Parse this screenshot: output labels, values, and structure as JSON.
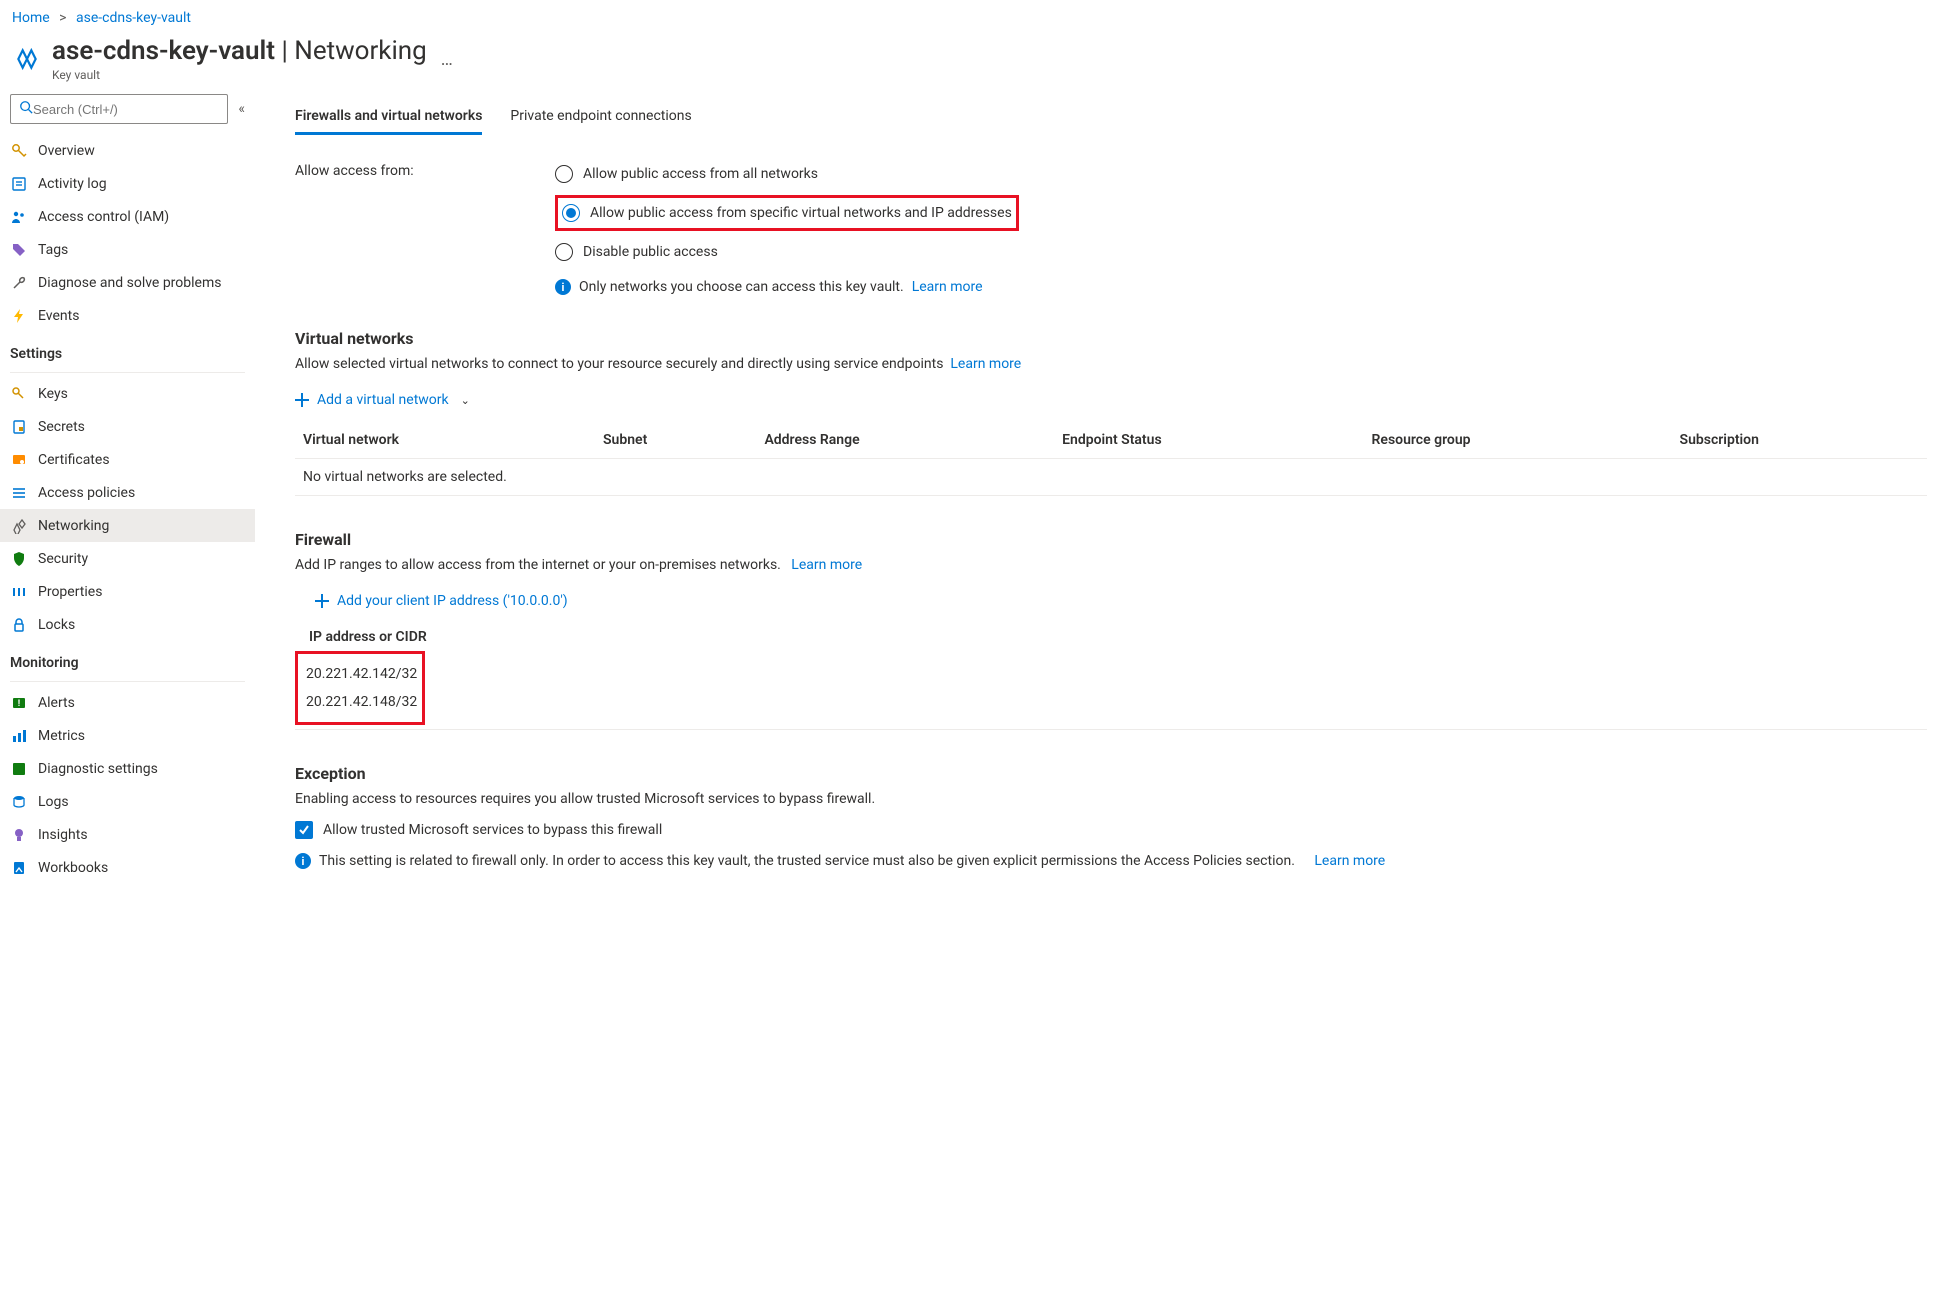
{
  "breadcrumb": {
    "home": "Home",
    "resource": "ase-cdns-key-vault"
  },
  "header": {
    "title_main": "ase-cdns-key-vault",
    "title_sep": " | ",
    "title_sub": "Networking",
    "subtitle": "Key vault",
    "more": "…"
  },
  "search": {
    "placeholder": "Search (Ctrl+/)"
  },
  "sidebar": {
    "items_top": [
      {
        "label": "Overview"
      },
      {
        "label": "Activity log"
      },
      {
        "label": "Access control (IAM)"
      },
      {
        "label": "Tags"
      },
      {
        "label": "Diagnose and solve problems"
      },
      {
        "label": "Events"
      }
    ],
    "section_settings": "Settings",
    "items_settings": [
      {
        "label": "Keys"
      },
      {
        "label": "Secrets"
      },
      {
        "label": "Certificates"
      },
      {
        "label": "Access policies"
      },
      {
        "label": "Networking",
        "active": true
      },
      {
        "label": "Security"
      },
      {
        "label": "Properties"
      },
      {
        "label": "Locks"
      }
    ],
    "section_monitoring": "Monitoring",
    "items_monitoring": [
      {
        "label": "Alerts"
      },
      {
        "label": "Metrics"
      },
      {
        "label": "Diagnostic settings"
      },
      {
        "label": "Logs"
      },
      {
        "label": "Insights"
      },
      {
        "label": "Workbooks"
      }
    ]
  },
  "tabs": {
    "firewalls": "Firewalls and virtual networks",
    "private": "Private endpoint connections"
  },
  "access": {
    "label": "Allow access from:",
    "opt_all": "Allow public access from all networks",
    "opt_specific": "Allow public access from specific virtual networks and IP addresses",
    "opt_disable": "Disable public access",
    "info_text": "Only networks you choose can access this key vault.",
    "info_link": "Learn more"
  },
  "vnet": {
    "heading": "Virtual networks",
    "desc": "Allow selected virtual networks to connect to your resource securely and directly using service endpoints",
    "desc_link": "Learn more",
    "add": "Add a virtual network",
    "cols": {
      "c1": "Virtual network",
      "c2": "Subnet",
      "c3": "Address Range",
      "c4": "Endpoint Status",
      "c5": "Resource group",
      "c6": "Subscription"
    },
    "empty": "No virtual networks are selected."
  },
  "firewall": {
    "heading": "Firewall",
    "desc": "Add IP ranges to allow access from the internet or your on-premises networks.",
    "desc_link": "Learn more",
    "add_client": "Add your client IP address ('10.0.0.0')",
    "col_header": "IP address or CIDR",
    "ips": [
      "20.221.42.142/32",
      "20.221.42.148/32"
    ]
  },
  "exception": {
    "heading": "Exception",
    "desc": "Enabling access to resources requires you allow trusted Microsoft services to bypass firewall.",
    "chk_label": "Allow trusted Microsoft services to bypass this firewall",
    "note": "This setting is related to firewall only. In order to access this key vault, the trusted service must also be given explicit permissions the Access Policies section.",
    "note_link": "Learn more"
  }
}
